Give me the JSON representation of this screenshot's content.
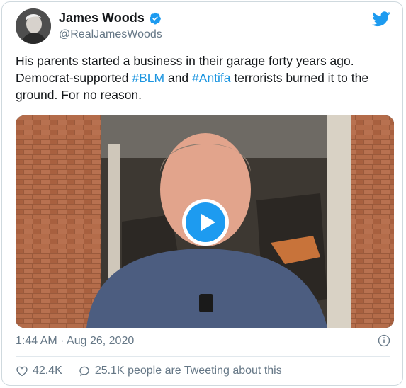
{
  "author": {
    "name": "James Woods",
    "handle": "@RealJamesWoods"
  },
  "tweet": {
    "text_part1": "His parents started a business in their garage forty years ago. Democrat-supported ",
    "hashtag1": "#BLM",
    "text_part2": " and  ",
    "hashtag2": "#Antifa",
    "text_part3": " terrorists burned it to the ground. For no reason."
  },
  "meta": {
    "timestamp": "1:44 AM · Aug 26, 2020"
  },
  "actions": {
    "likes": "42.4K",
    "conversation": "25.1K people are Tweeting about this"
  },
  "icons": {
    "verified": "verified-badge-icon",
    "twitter": "twitter-bird-icon",
    "play": "play-icon",
    "info": "info-icon",
    "like": "heart-icon",
    "conversation": "reply-icon"
  },
  "colors": {
    "accent": "#1d9bf0",
    "secondary_text": "#657786",
    "hashtag": "#1b95e0"
  }
}
